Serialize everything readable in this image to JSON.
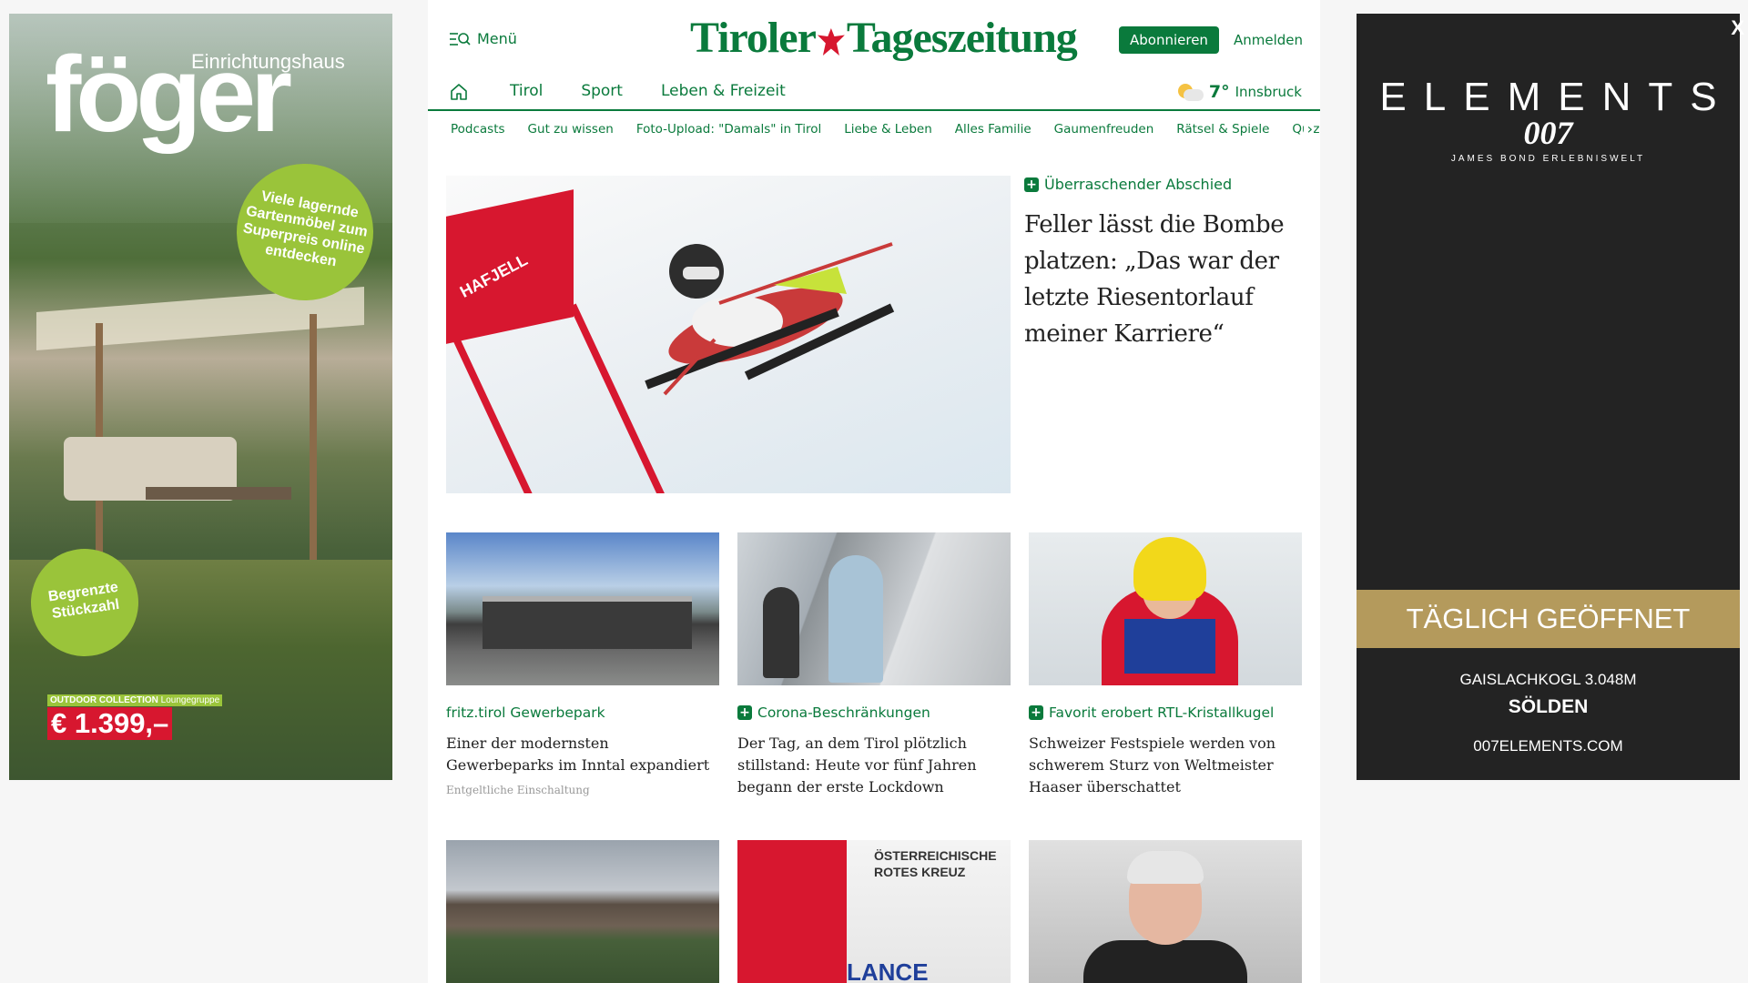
{
  "ad_left": {
    "brand_sub": "Einrichtungshaus",
    "brand": "föger",
    "bubble_top": "Viele lagernde Gartenmöbel zum Superpreis online entdecken",
    "bubble_bottom": "Begrenzte Stückzahl",
    "collection_label": "OUTDOOR COLLECTION",
    "collection_sub": "Loungegruppe",
    "price": "€ 1.399,–"
  },
  "ad_right": {
    "close": "X",
    "brand": "ELEMENTS",
    "bond": "007",
    "sub": "JAMES BOND ERLEBNISWELT",
    "band": "TÄGLICH GEÖFFNET",
    "location": "GAISLACHKOGL 3.048M",
    "town": "SÖLDEN",
    "website": "007ELEMENTS.COM"
  },
  "header": {
    "menu_label": "Menü",
    "logo_left": "Tiroler",
    "logo_right": "Tageszeitung",
    "subscribe_label": "Abonnieren",
    "login_label": "Anmelden"
  },
  "nav": {
    "items": [
      "Tirol",
      "Sport",
      "Leben & Freizeit"
    ],
    "weather": {
      "temp": "7°",
      "city": "Innsbruck"
    }
  },
  "subnav": {
    "items": [
      "Podcasts",
      "Gut zu wissen",
      "Foto-Upload: \"Damals\" in Tirol",
      "Liebe & Leben",
      "Alles Familie",
      "Gaumenfreuden",
      "Rätsel & Spiele",
      "Quiz"
    ]
  },
  "hero": {
    "kicker": "Überraschender Abschied",
    "title": "Feller lässt die Bombe platzen: „Das war der letzte Riesentorlauf meiner Karriere“",
    "image_text": "HAFJELL"
  },
  "cards": [
    {
      "kicker": "fritz.tirol Gewerbepark",
      "title": "Einer der modernsten Gewerbeparks im Inntal expandiert",
      "paid": "Entgeltliche Einschaltung"
    },
    {
      "kicker": "Corona-Beschränkungen",
      "title": "Der Tag, an dem Tirol plötzlich stillstand: Heute vor fünf Jahren begann der erste Lockdown"
    },
    {
      "kicker": "Favorit erobert RTL-Kristallkugel",
      "title": "Schweizer Festspiele werden von schwerem Sturz von Weltmeister Haaser überschattet"
    }
  ],
  "cards_row2": {
    "image_text_e": "ÖSTERREICHISCHE ROTES KREUZ",
    "image_text_e2": "LANCE"
  }
}
